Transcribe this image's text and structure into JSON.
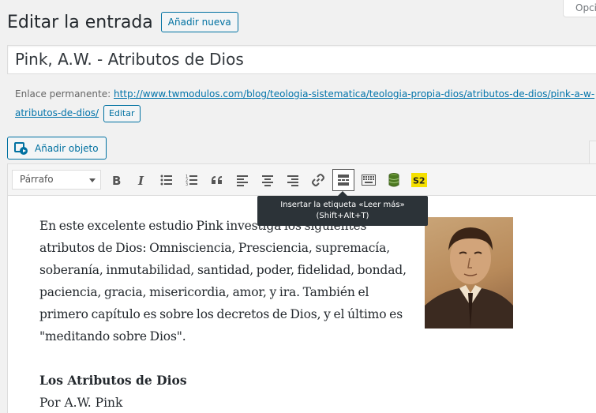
{
  "screen_options": "Opciones de pantalla",
  "header": {
    "title": "Editar la entrada",
    "add_new": "Añadir nueva"
  },
  "post_title": "Pink, A.W. - Atributos de Dios",
  "permalink": {
    "label": "Enlace permanente:",
    "url": "http://www.twmodulos.com/blog/teologia-sistematica/teologia-propia-dios/atributos-de-dios/pink-a-w-atributos-de-dios/",
    "edit": "Editar"
  },
  "add_media": "Añadir objeto",
  "toolbar": {
    "format": "Párrafo",
    "buttons": [
      "bold-icon",
      "italic-icon",
      "bullet-list-icon",
      "numbered-list-icon",
      "blockquote-icon",
      "align-left-icon",
      "align-center-icon",
      "align-right-icon",
      "link-icon",
      "read-more-icon",
      "toolbar-toggle-icon",
      "database-icon",
      "s2-icon"
    ],
    "s2_label": "S2"
  },
  "tooltip": {
    "line1": "Insertar la etiqueta «Leer más»",
    "line2": "(Shift+Alt+T)"
  },
  "content": {
    "paragraph1": "En este excelente estudio Pink investiga los siguientes atributos de Dios: Omnisciencia, Presciencia, supremacía, soberanía, inmutabilidad, santidad, poder, fidelidad, bondad, paciencia, gracia, misericordia, amor, y ira. También el primero capítulo es sobre los decretos de Dios, y el último es \"meditando sobre Dios\".",
    "heading": "Los Atributos de Dios",
    "byline": "Por A.W. Pink"
  },
  "colors": {
    "accent": "#0071a1",
    "link": "#0073aa",
    "tooltip_bg": "#2c3338",
    "s2_yellow": "#f5e000"
  }
}
